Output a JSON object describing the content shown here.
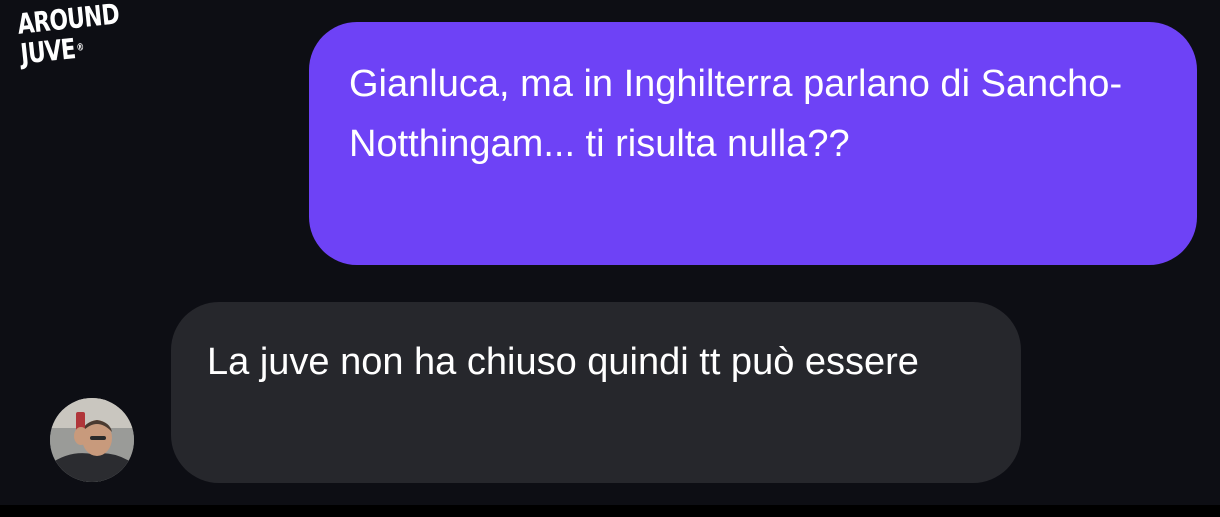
{
  "logo": {
    "line1": "AROUND",
    "line2": "JUVE",
    "mark": "®"
  },
  "conversation": {
    "messages": [
      {
        "direction": "sent",
        "text": "Gianluca, ma in Inghilterra parlano di Sancho-Notthingam... ti risulta nulla??",
        "bubble_color": "#6e42f6"
      },
      {
        "direction": "received",
        "text": "La juve non ha chiuso quindi tt può essere",
        "bubble_color": "#26272c",
        "avatar": "person-photo-avatar"
      }
    ]
  },
  "colors": {
    "background": "#0d0e14",
    "sent_bubble": "#6e42f6",
    "received_bubble": "#26272c",
    "text": "#ffffff"
  }
}
